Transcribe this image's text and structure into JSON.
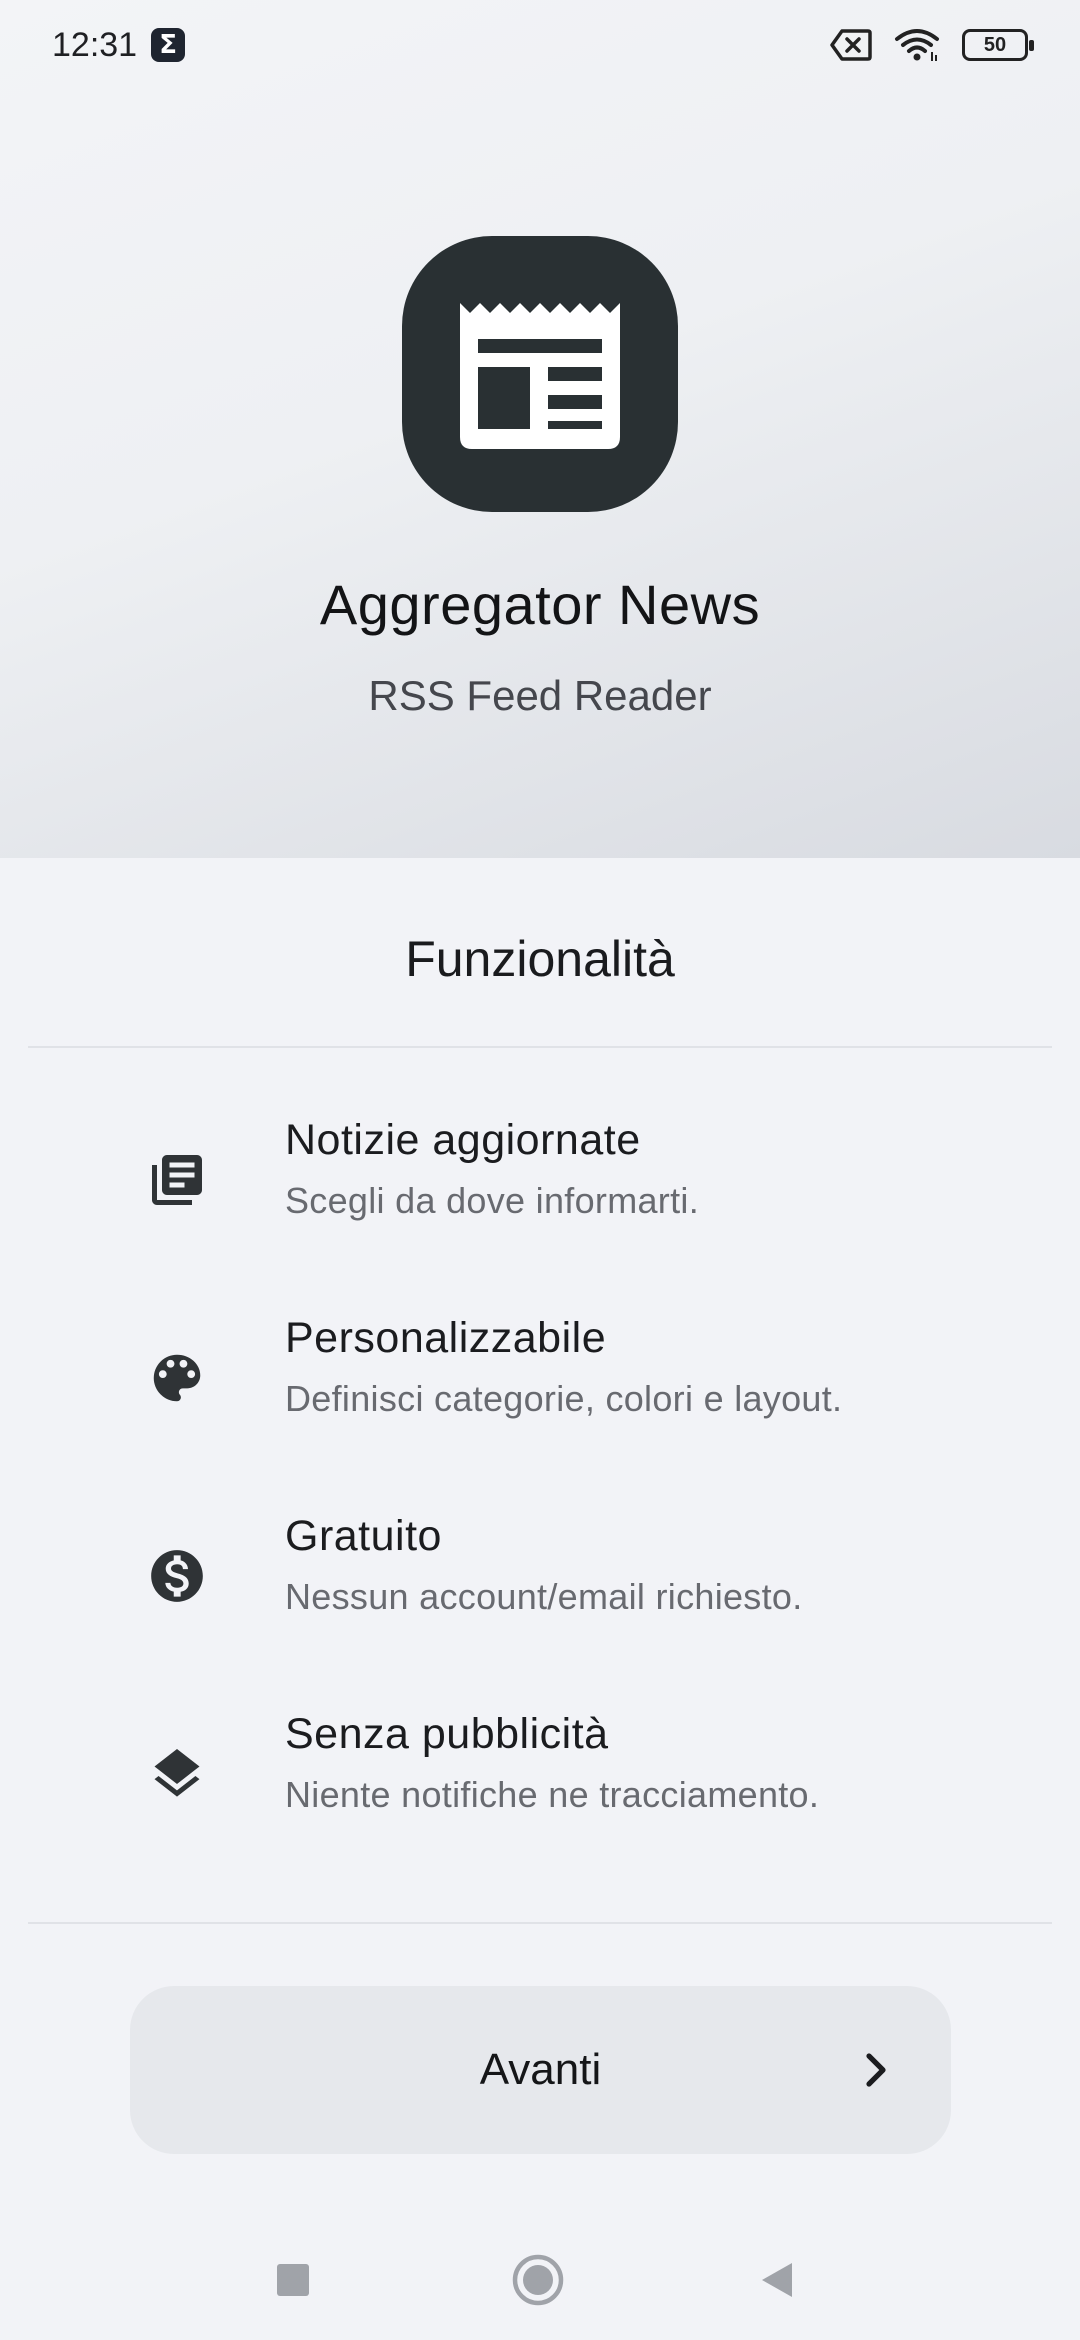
{
  "status_bar": {
    "time": "12:31",
    "notification_icon": "sigma-icon",
    "sigma_glyph": "Σ",
    "battery_level": "50",
    "icons": [
      "sim-error-icon",
      "wifi-icon",
      "battery-icon"
    ]
  },
  "hero": {
    "app_icon": "newspaper-icon",
    "title": "Aggregator News",
    "subtitle": "RSS Feed Reader",
    "icon_bg_color": "#293033"
  },
  "features": {
    "section_title": "Funzionalità",
    "items": [
      {
        "icon": "news-icon",
        "title": "Notizie aggiornate",
        "description": "Scegli da dove informarti."
      },
      {
        "icon": "palette-icon",
        "title": "Personalizzabile",
        "description": "Definisci categorie, colori e layout."
      },
      {
        "icon": "dollar-icon",
        "title": "Gratuito",
        "description": "Nessun account/email richiesto."
      },
      {
        "icon": "layers-icon",
        "title": "Senza pubblicità",
        "description": "Niente notifiche ne tracciamento."
      }
    ]
  },
  "next_button": {
    "label": "Avanti",
    "icon": "chevron-right-icon"
  },
  "navigation": {
    "icons": [
      "recents-icon",
      "home-icon",
      "back-icon"
    ]
  }
}
